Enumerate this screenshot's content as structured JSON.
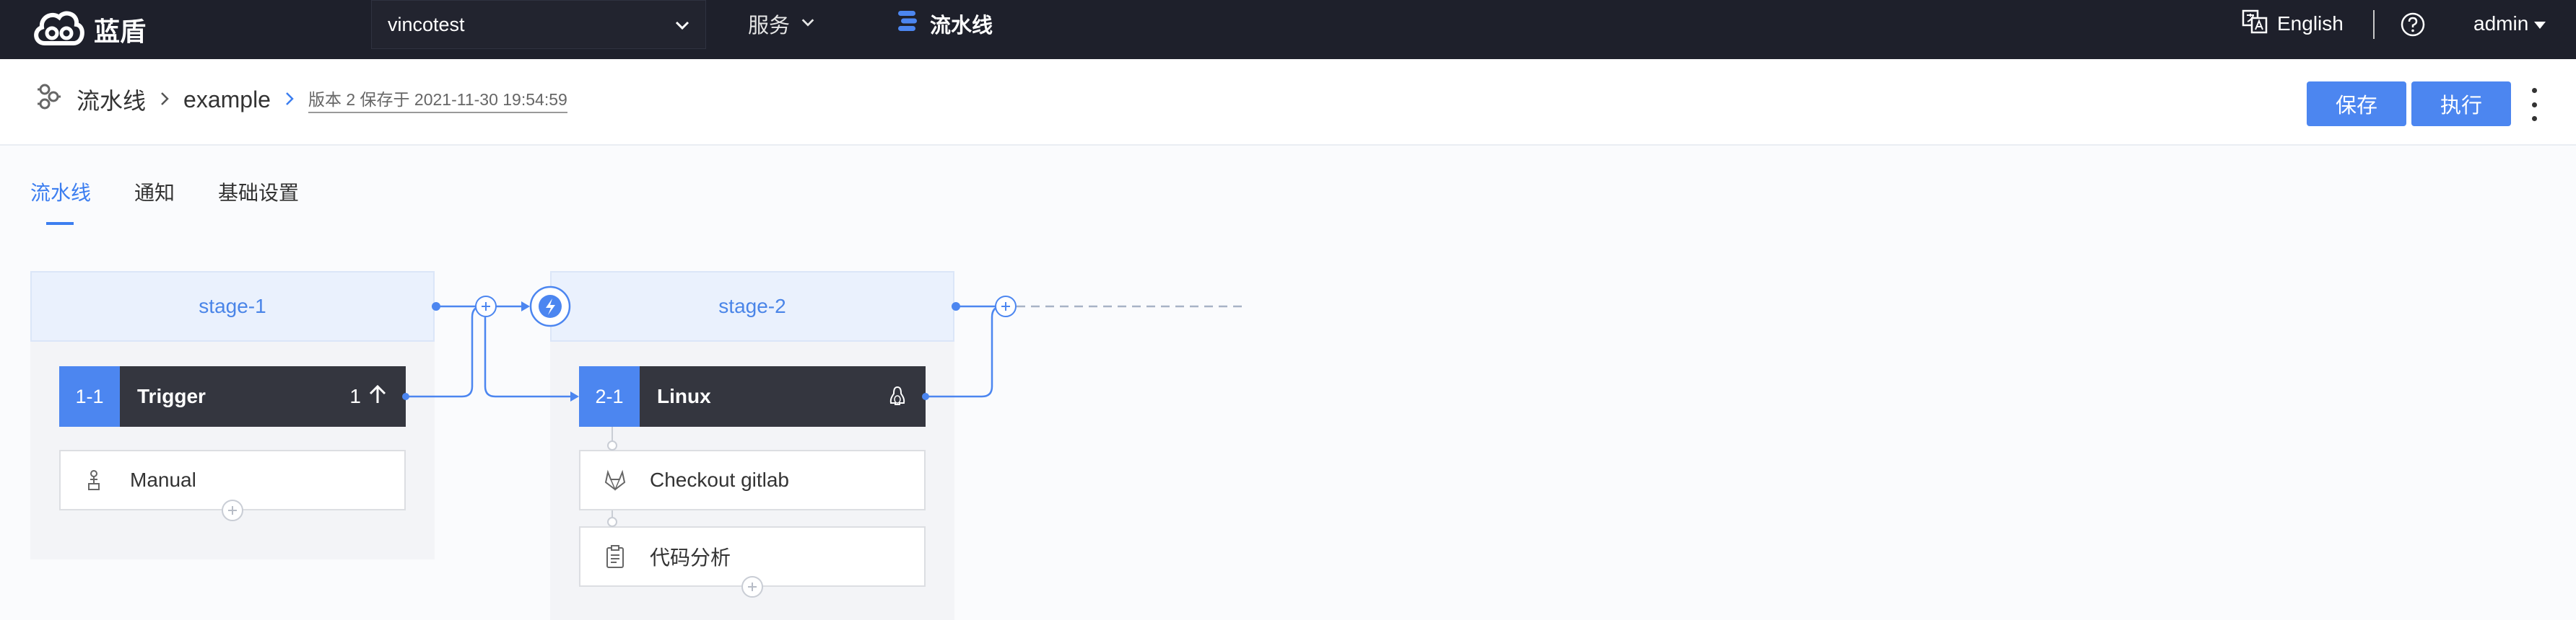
{
  "topbar": {
    "brand": "蓝盾",
    "project": "vincotest",
    "services_label": "服务",
    "pipeline_label": "流水线",
    "language": "English",
    "user": "admin"
  },
  "breadcrumb": {
    "root": "流水线",
    "pipeline_name": "example",
    "version": "版本 2 保存于 2021-11-30 19:54:59"
  },
  "actions": {
    "save": "保存",
    "run": "执行"
  },
  "tabs": [
    "流水线",
    "通知",
    "基础设置"
  ],
  "stages": [
    {
      "name": "stage-1",
      "job": {
        "id": "1-1",
        "name": "Trigger",
        "badge": "1"
      },
      "steps": [
        "Manual"
      ]
    },
    {
      "name": "stage-2",
      "job": {
        "id": "2-1",
        "name": "Linux"
      },
      "steps": [
        "Checkout gitlab",
        "代码分析"
      ]
    }
  ],
  "colors": {
    "topbar_bg": "#1e202b",
    "accent": "#4c86f0",
    "job_bg": "#34363f",
    "stage_head_bg": "#eaf1fd"
  }
}
